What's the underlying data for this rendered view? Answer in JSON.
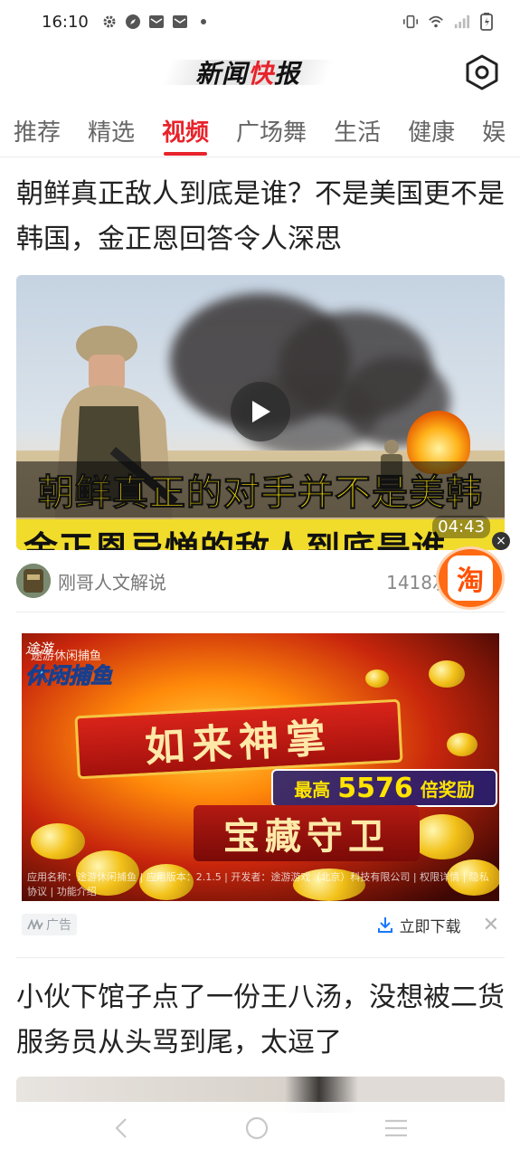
{
  "status_bar": {
    "time": "16:10"
  },
  "header": {
    "logo_part1": "新闻",
    "logo_part2": "快",
    "logo_part3": "报"
  },
  "tabs": [
    {
      "label": "推荐",
      "active": false
    },
    {
      "label": "精选",
      "active": false
    },
    {
      "label": "视频",
      "active": true
    },
    {
      "label": "广场舞",
      "active": false
    },
    {
      "label": "生活",
      "active": false
    },
    {
      "label": "健康",
      "active": false
    },
    {
      "label": "娱",
      "active": false
    }
  ],
  "article1": {
    "title": "朝鲜真正敌人到底是谁？不是美国更不是韩国，金正恩回答令人深思",
    "overlay_line1": "朝鲜真正的对手并不是美韩",
    "overlay_line2": "金正恩忌惮的敌人到底是谁",
    "duration": "04:43",
    "author": "刚哥人文解说",
    "views": "1418次"
  },
  "taobao": {
    "char": "淘"
  },
  "ad": {
    "logo_top": "途游",
    "logo_main": "休闲捕鱼",
    "logo_overlay": "途游休闲捕鱼",
    "banner_text": "如来神掌",
    "bonus_prefix": "最高",
    "bonus_value": "5576",
    "bonus_suffix": "倍奖励",
    "subbanner_text": "宝藏守卫",
    "fineprint": "应用名称：途游休闲捕鱼 | 应用版本：2.1.5 | 开发者：途游游戏（北京）科技有限公司 | 权限详情 | 隐私协议 | 功能介绍",
    "badge_label": "广告",
    "download_label": "立即下载"
  },
  "article2": {
    "title": "小伙下馆子点了一份王八汤，没想被二货服务员从头骂到尾，太逗了"
  },
  "colors": {
    "accent": "#e8232b",
    "taobao": "#ff6a13",
    "link": "#1677ff"
  }
}
